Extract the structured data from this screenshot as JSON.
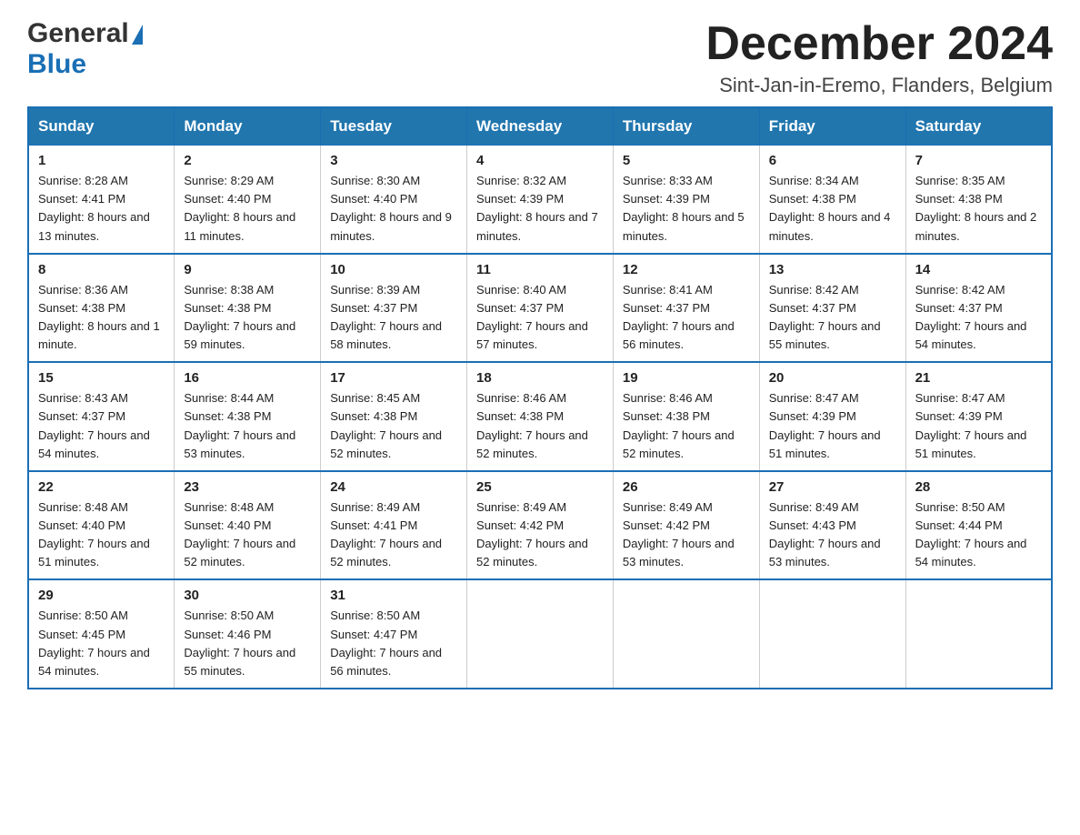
{
  "header": {
    "logo_general": "General",
    "logo_blue": "Blue",
    "title": "December 2024",
    "subtitle": "Sint-Jan-in-Eremo, Flanders, Belgium"
  },
  "days_of_week": [
    "Sunday",
    "Monday",
    "Tuesday",
    "Wednesday",
    "Thursday",
    "Friday",
    "Saturday"
  ],
  "weeks": [
    [
      {
        "day": "1",
        "sunrise": "8:28 AM",
        "sunset": "4:41 PM",
        "daylight": "8 hours and 13 minutes."
      },
      {
        "day": "2",
        "sunrise": "8:29 AM",
        "sunset": "4:40 PM",
        "daylight": "8 hours and 11 minutes."
      },
      {
        "day": "3",
        "sunrise": "8:30 AM",
        "sunset": "4:40 PM",
        "daylight": "8 hours and 9 minutes."
      },
      {
        "day": "4",
        "sunrise": "8:32 AM",
        "sunset": "4:39 PM",
        "daylight": "8 hours and 7 minutes."
      },
      {
        "day": "5",
        "sunrise": "8:33 AM",
        "sunset": "4:39 PM",
        "daylight": "8 hours and 5 minutes."
      },
      {
        "day": "6",
        "sunrise": "8:34 AM",
        "sunset": "4:38 PM",
        "daylight": "8 hours and 4 minutes."
      },
      {
        "day": "7",
        "sunrise": "8:35 AM",
        "sunset": "4:38 PM",
        "daylight": "8 hours and 2 minutes."
      }
    ],
    [
      {
        "day": "8",
        "sunrise": "8:36 AM",
        "sunset": "4:38 PM",
        "daylight": "8 hours and 1 minute."
      },
      {
        "day": "9",
        "sunrise": "8:38 AM",
        "sunset": "4:38 PM",
        "daylight": "7 hours and 59 minutes."
      },
      {
        "day": "10",
        "sunrise": "8:39 AM",
        "sunset": "4:37 PM",
        "daylight": "7 hours and 58 minutes."
      },
      {
        "day": "11",
        "sunrise": "8:40 AM",
        "sunset": "4:37 PM",
        "daylight": "7 hours and 57 minutes."
      },
      {
        "day": "12",
        "sunrise": "8:41 AM",
        "sunset": "4:37 PM",
        "daylight": "7 hours and 56 minutes."
      },
      {
        "day": "13",
        "sunrise": "8:42 AM",
        "sunset": "4:37 PM",
        "daylight": "7 hours and 55 minutes."
      },
      {
        "day": "14",
        "sunrise": "8:42 AM",
        "sunset": "4:37 PM",
        "daylight": "7 hours and 54 minutes."
      }
    ],
    [
      {
        "day": "15",
        "sunrise": "8:43 AM",
        "sunset": "4:37 PM",
        "daylight": "7 hours and 54 minutes."
      },
      {
        "day": "16",
        "sunrise": "8:44 AM",
        "sunset": "4:38 PM",
        "daylight": "7 hours and 53 minutes."
      },
      {
        "day": "17",
        "sunrise": "8:45 AM",
        "sunset": "4:38 PM",
        "daylight": "7 hours and 52 minutes."
      },
      {
        "day": "18",
        "sunrise": "8:46 AM",
        "sunset": "4:38 PM",
        "daylight": "7 hours and 52 minutes."
      },
      {
        "day": "19",
        "sunrise": "8:46 AM",
        "sunset": "4:38 PM",
        "daylight": "7 hours and 52 minutes."
      },
      {
        "day": "20",
        "sunrise": "8:47 AM",
        "sunset": "4:39 PM",
        "daylight": "7 hours and 51 minutes."
      },
      {
        "day": "21",
        "sunrise": "8:47 AM",
        "sunset": "4:39 PM",
        "daylight": "7 hours and 51 minutes."
      }
    ],
    [
      {
        "day": "22",
        "sunrise": "8:48 AM",
        "sunset": "4:40 PM",
        "daylight": "7 hours and 51 minutes."
      },
      {
        "day": "23",
        "sunrise": "8:48 AM",
        "sunset": "4:40 PM",
        "daylight": "7 hours and 52 minutes."
      },
      {
        "day": "24",
        "sunrise": "8:49 AM",
        "sunset": "4:41 PM",
        "daylight": "7 hours and 52 minutes."
      },
      {
        "day": "25",
        "sunrise": "8:49 AM",
        "sunset": "4:42 PM",
        "daylight": "7 hours and 52 minutes."
      },
      {
        "day": "26",
        "sunrise": "8:49 AM",
        "sunset": "4:42 PM",
        "daylight": "7 hours and 53 minutes."
      },
      {
        "day": "27",
        "sunrise": "8:49 AM",
        "sunset": "4:43 PM",
        "daylight": "7 hours and 53 minutes."
      },
      {
        "day": "28",
        "sunrise": "8:50 AM",
        "sunset": "4:44 PM",
        "daylight": "7 hours and 54 minutes."
      }
    ],
    [
      {
        "day": "29",
        "sunrise": "8:50 AM",
        "sunset": "4:45 PM",
        "daylight": "7 hours and 54 minutes."
      },
      {
        "day": "30",
        "sunrise": "8:50 AM",
        "sunset": "4:46 PM",
        "daylight": "7 hours and 55 minutes."
      },
      {
        "day": "31",
        "sunrise": "8:50 AM",
        "sunset": "4:47 PM",
        "daylight": "7 hours and 56 minutes."
      },
      null,
      null,
      null,
      null
    ]
  ]
}
